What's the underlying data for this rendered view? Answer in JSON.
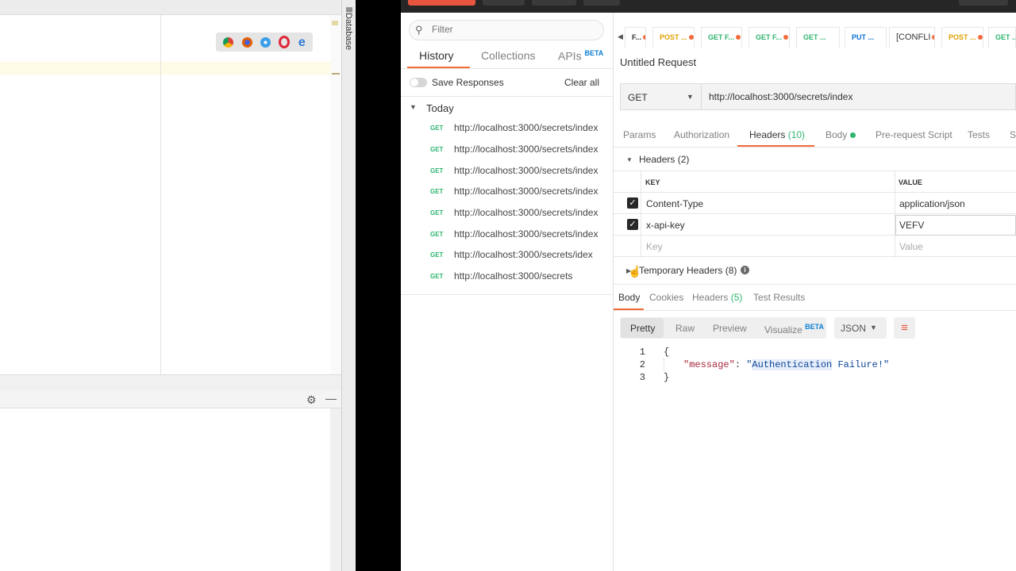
{
  "ide": {
    "toolwin": {
      "gear_icon": "gear-icon",
      "minimize_icon": "minimize-icon"
    },
    "database_label": "Database"
  },
  "sidebar": {
    "filter_placeholder": "Filter",
    "tabs": {
      "history": "History",
      "collections": "Collections",
      "apis": "APIs",
      "apis_badge": "BETA"
    },
    "save_responses": "Save Responses",
    "clear_all": "Clear all",
    "group": "Today",
    "history": [
      {
        "method": "GET",
        "url": "http://localhost:3000/secrets/index"
      },
      {
        "method": "GET",
        "url": "http://localhost:3000/secrets/index"
      },
      {
        "method": "GET",
        "url": "http://localhost:3000/secrets/index"
      },
      {
        "method": "GET",
        "url": "http://localhost:3000/secrets/index"
      },
      {
        "method": "GET",
        "url": "http://localhost:3000/secrets/index"
      },
      {
        "method": "GET",
        "url": "http://localhost:3000/secrets/index"
      },
      {
        "method": "GET",
        "url": "http://localhost:3000/secrets/idex"
      },
      {
        "method": "GET",
        "url": "http://localhost:3000/secrets"
      }
    ]
  },
  "request_tabs": [
    {
      "label": "F...",
      "color": "#333333"
    },
    {
      "label": "POST ...",
      "color": "#e0a100"
    },
    {
      "label": "GET F...",
      "color": "#2eb56f"
    },
    {
      "label": "GET F...",
      "color": "#2eb56f"
    },
    {
      "label": "GET ...",
      "color": "#2eb56f"
    },
    {
      "label": "PUT ...",
      "color": "#0c6fd4"
    },
    {
      "label": "[CONFLI",
      "color": "#333333"
    },
    {
      "label": "POST ...",
      "color": "#e0a100"
    },
    {
      "label": "GET ...",
      "color": "#2eb56f"
    }
  ],
  "request": {
    "title": "Untitled Request",
    "method": "GET",
    "url": "http://localhost:3000/secrets/index"
  },
  "request_sub_tabs": {
    "params": "Params",
    "authorization": "Authorization",
    "headers": "Headers",
    "headers_count": "(10)",
    "body": "Body",
    "pre_request": "Pre-request Script",
    "tests": "Tests",
    "settings": "S"
  },
  "headers_section": {
    "title": "Headers (2)",
    "col_key": "KEY",
    "col_value": "VALUE",
    "rows": [
      {
        "key": "Content-Type",
        "value": "application/json"
      },
      {
        "key": "x-api-key",
        "value": "VEFV"
      }
    ],
    "placeholder_key": "Key",
    "placeholder_value": "Value",
    "temporary": "Temporary Headers (8)"
  },
  "response_tabs": {
    "body": "Body",
    "cookies": "Cookies",
    "headers": "Headers",
    "headers_count": "(5)",
    "test_results": "Test Results"
  },
  "view_modes": {
    "pretty": "Pretty",
    "raw": "Raw",
    "preview": "Preview",
    "visualize": "Visualize",
    "visualize_badge": "BETA"
  },
  "format": "JSON",
  "response_body": {
    "line1": "{",
    "key": "\"message\"",
    "colon": ": ",
    "quote_open": "\"",
    "highlight": "Authentication",
    "value_rest": " Failure!\"",
    "line3": "}"
  },
  "colors": {
    "accent": "#f26b3a",
    "get": "#2eb56f",
    "post": "#e0a100",
    "put": "#0c6fd4"
  }
}
